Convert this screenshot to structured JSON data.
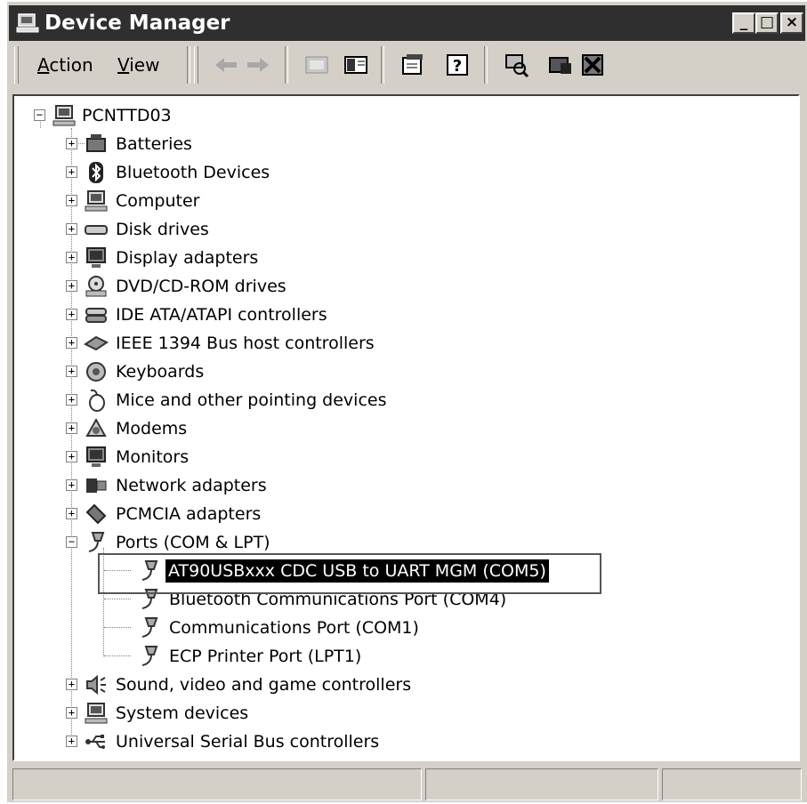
{
  "window": {
    "title": "Device Manager",
    "controls": {
      "minimize": "_",
      "maximize": "□",
      "close": "×"
    }
  },
  "menu": {
    "action": "Action",
    "view": "View"
  },
  "tree": {
    "root": "PCNTTD03",
    "categories": [
      {
        "label": "Batteries",
        "icon": "battery-icon"
      },
      {
        "label": "Bluetooth Devices",
        "icon": "bluetooth-icon"
      },
      {
        "label": "Computer",
        "icon": "computer-icon"
      },
      {
        "label": "Disk drives",
        "icon": "disk-drive-icon"
      },
      {
        "label": "Display adapters",
        "icon": "display-adapter-icon"
      },
      {
        "label": "DVD/CD-ROM drives",
        "icon": "dvd-drive-icon"
      },
      {
        "label": "IDE ATA/ATAPI controllers",
        "icon": "ide-controller-icon"
      },
      {
        "label": "IEEE 1394 Bus host controllers",
        "icon": "ieee1394-icon"
      },
      {
        "label": "Keyboards",
        "icon": "keyboard-icon"
      },
      {
        "label": "Mice and other pointing devices",
        "icon": "mouse-icon"
      },
      {
        "label": "Modems",
        "icon": "modem-icon"
      },
      {
        "label": "Monitors",
        "icon": "monitor-icon"
      },
      {
        "label": "Network adapters",
        "icon": "network-adapter-icon"
      },
      {
        "label": "PCMCIA adapters",
        "icon": "pcmcia-icon"
      },
      {
        "label": "Ports (COM & LPT)",
        "icon": "port-icon"
      },
      {
        "label": "Sound, video and game controllers",
        "icon": "sound-icon"
      },
      {
        "label": "System devices",
        "icon": "system-device-icon"
      },
      {
        "label": "Universal Serial Bus controllers",
        "icon": "usb-icon"
      }
    ],
    "ports_children": [
      {
        "label": "AT90USBxxx CDC USB to UART MGM (COM5)",
        "selected": true
      },
      {
        "label": "Bluetooth Communications Port (COM4)",
        "selected": false
      },
      {
        "label": "Communications Port (COM1)",
        "selected": false
      },
      {
        "label": "ECP Printer Port (LPT1)",
        "selected": false
      }
    ]
  },
  "colors": {
    "title_bar": "#2f2f2f",
    "chrome": "#d4d0c8",
    "selection": "#000000"
  }
}
